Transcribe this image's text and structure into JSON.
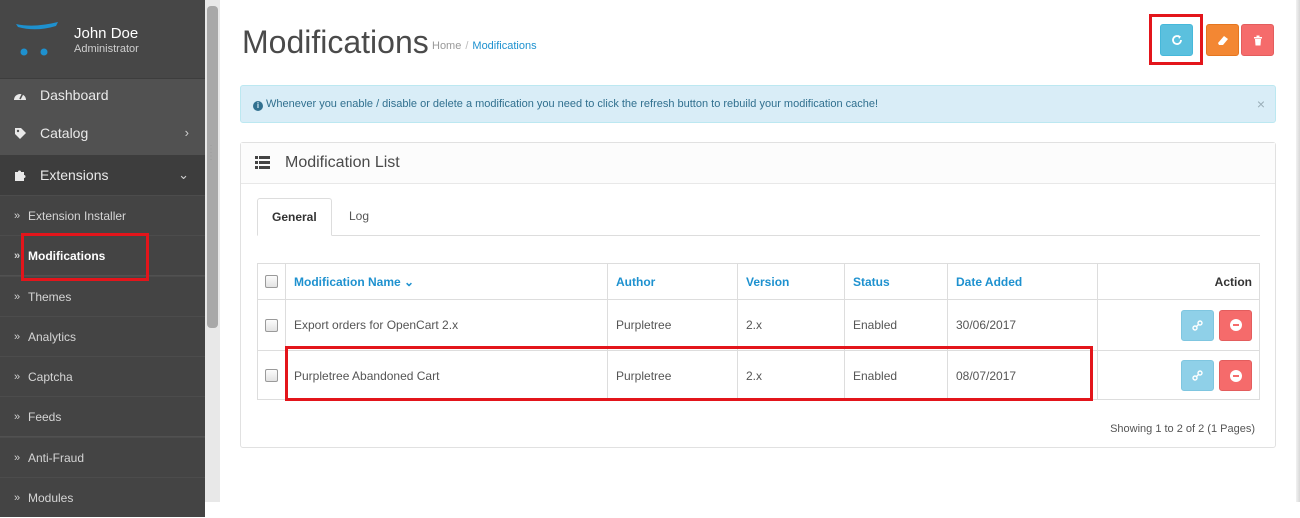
{
  "user": {
    "name": "John Doe",
    "role": "Administrator"
  },
  "sidebar": {
    "items": [
      {
        "label": "Dashboard",
        "icon": "dashboard-icon"
      },
      {
        "label": "Catalog",
        "icon": "tag-icon",
        "chevron": "›"
      },
      {
        "label": "Extensions",
        "icon": "puzzle-icon",
        "chevron": "⌄"
      }
    ],
    "subitems": [
      {
        "label": "Extension Installer",
        "chevron": "»"
      },
      {
        "label": "Modifications",
        "chevron": "»",
        "active": true
      },
      {
        "label": "Themes",
        "chevron": "»"
      },
      {
        "label": "Analytics",
        "chevron": "»"
      },
      {
        "label": "Captcha",
        "chevron": "»"
      },
      {
        "label": "Feeds",
        "chevron": "»"
      },
      {
        "label": "Anti-Fraud",
        "chevron": "»"
      },
      {
        "label": "Modules",
        "chevron": "»"
      }
    ]
  },
  "header": {
    "title": "Modifications",
    "breadcrumb": {
      "home": "Home",
      "separator": "/",
      "current": "Modifications"
    },
    "buttons": {
      "refresh_icon": "refresh-icon",
      "clear_icon": "eraser-icon",
      "delete_icon": "trash-icon"
    }
  },
  "alert": {
    "text": "Whenever you enable / disable or delete a modification you need to click the refresh button to rebuild your modification cache!",
    "close": "×"
  },
  "panel": {
    "title": "Modification List",
    "tabs": [
      {
        "label": "General"
      },
      {
        "label": "Log"
      }
    ]
  },
  "table": {
    "headers": {
      "name": "Modification Name",
      "name_sort": "⌄",
      "author": "Author",
      "version": "Version",
      "status": "Status",
      "date": "Date Added",
      "action": "Action"
    },
    "rows": [
      {
        "name": "Export orders for OpenCart 2.x",
        "author": "Purpletree",
        "version": "2.x",
        "status": "Enabled",
        "date": "30/06/2017"
      },
      {
        "name": "Purpletree Abandoned Cart",
        "author": "Purpletree",
        "version": "2.x",
        "status": "Enabled",
        "date": "08/07/2017"
      }
    ],
    "pagination": "Showing 1 to 2 of 2 (1 Pages)"
  },
  "colors": {
    "sidebar_bg": "#515151",
    "accent_blue": "#1e91cf",
    "info_btn": "#5bc0de",
    "warning_btn": "#f38733",
    "danger_btn": "#f56b6b",
    "highlight_red": "#e3151b"
  }
}
